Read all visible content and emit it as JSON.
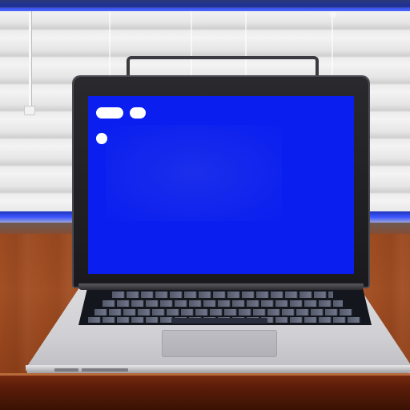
{
  "scene": {
    "description_tags": [
      "laptop-on-desk",
      "window-blinds",
      "blue-screen"
    ],
    "colors": {
      "screen": "#0a1ef0",
      "desk": "#a24f24",
      "accent_light": "#3350ff",
      "laptop_body": "#cfcfd3"
    },
    "screen_ui": {
      "elements": [
        "pill",
        "pill",
        "dot"
      ]
    }
  }
}
